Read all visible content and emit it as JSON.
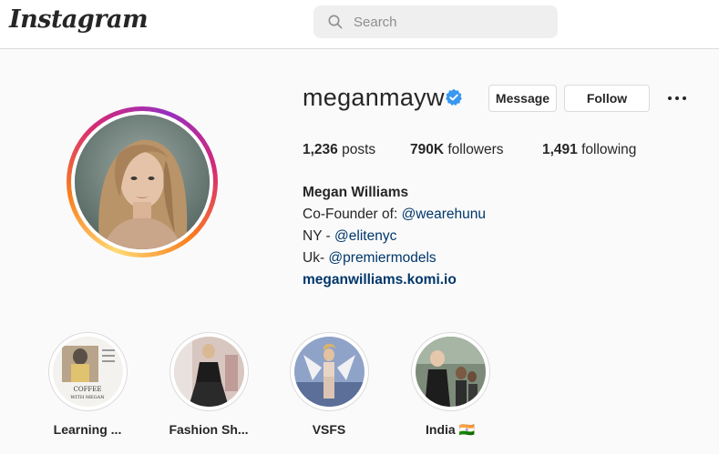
{
  "app": {
    "logo_text": "Instagram"
  },
  "search": {
    "placeholder": "Search"
  },
  "profile": {
    "username": "meganmayw",
    "buttons": {
      "message": "Message",
      "follow": "Follow"
    },
    "stats": {
      "posts_count": "1,236",
      "posts_label": "posts",
      "followers_count": "790K",
      "followers_label": "followers",
      "following_count": "1,491",
      "following_label": "following"
    },
    "bio": {
      "full_name": "Megan Williams",
      "line1_prefix": "Co-Founder of: ",
      "line1_link": "@wearehunu",
      "line2_prefix": "NY - ",
      "line2_link": "@elitenyc",
      "line3_prefix": "Uk- ",
      "line3_link": "@premiermodels",
      "website": "meganwilliams.komi.io"
    }
  },
  "highlights": [
    {
      "label": "Learning ...",
      "cover_text_1": "COFFEE",
      "cover_text_2": "WITH MEGAN"
    },
    {
      "label": "Fashion Sh..."
    },
    {
      "label": "VSFS"
    },
    {
      "label": "India 🇮🇳"
    }
  ],
  "colors": {
    "link": "#00376b",
    "verified": "#3897f0",
    "border": "#dbdbdb",
    "background": "#fafafa"
  }
}
